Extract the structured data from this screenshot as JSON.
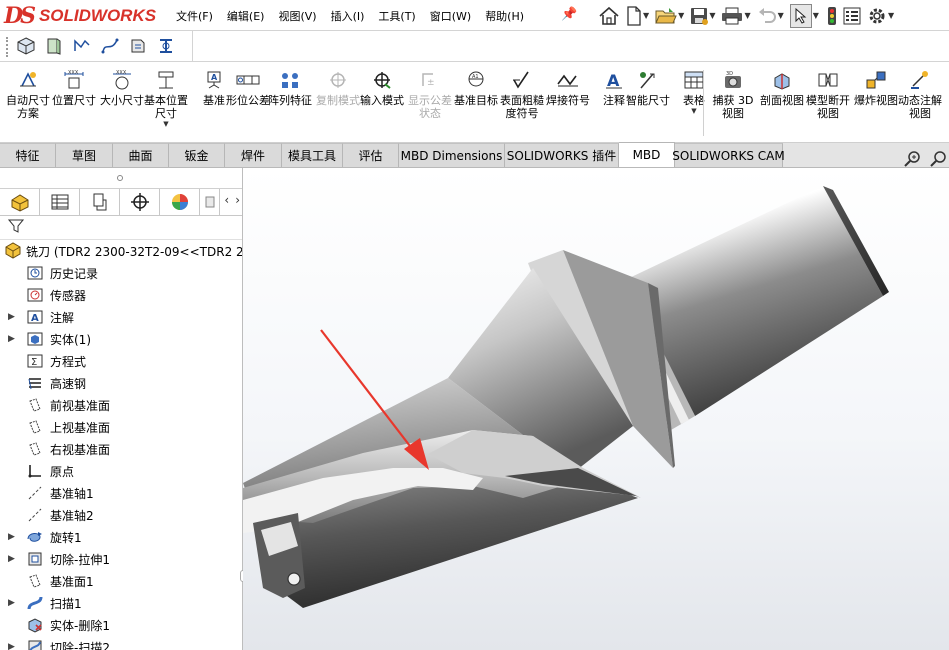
{
  "app": {
    "logo_ds": "DS",
    "logo_text": "SOLIDWORKS"
  },
  "menu": [
    "文件(F)",
    "编辑(E)",
    "视图(V)",
    "插入(I)",
    "工具(T)",
    "窗口(W)",
    "帮助(H)"
  ],
  "quick_access": {
    "icons": [
      "home-icon",
      "new-document-icon",
      "open-folder-icon",
      "save-icon",
      "print-icon",
      "undo-icon",
      "select-arrow-icon",
      "rebuild-traffic-light-icon",
      "file-properties-icon",
      "options-gear-icon"
    ]
  },
  "ribbon": {
    "buttons": [
      {
        "label": "自动尺寸方案",
        "icon": "auto-dimension-icon",
        "enabled": true
      },
      {
        "label": "位置尺寸",
        "icon": "location-dimension-icon",
        "enabled": true
      },
      {
        "label": "大小尺寸",
        "icon": "size-dimension-icon",
        "enabled": true
      },
      {
        "label": "基本位置尺寸",
        "icon": "basic-location-dimension-icon",
        "enabled": true,
        "has_dropdown": true
      },
      {
        "label": "基准",
        "icon": "datum-icon",
        "enabled": true
      },
      {
        "label": "形位公差",
        "icon": "geometric-tolerance-icon",
        "enabled": true
      },
      {
        "label": "阵列特征",
        "icon": "pattern-feature-icon",
        "enabled": true
      },
      {
        "label": "复制模式",
        "icon": "copy-scheme-icon",
        "enabled": false
      },
      {
        "label": "输入模式",
        "icon": "import-scheme-icon",
        "enabled": true
      },
      {
        "label": "显示公差状态",
        "icon": "show-tolerance-status-icon",
        "enabled": false
      },
      {
        "label": "基准目标",
        "icon": "datum-target-icon",
        "enabled": true
      },
      {
        "label": "表面粗糙度符号",
        "icon": "surface-finish-icon",
        "enabled": true
      },
      {
        "label": "焊接符号",
        "icon": "weld-symbol-icon",
        "enabled": true
      },
      {
        "label": "注释",
        "icon": "note-icon",
        "enabled": true
      },
      {
        "label": "智能尺寸",
        "icon": "smart-dimension-icon",
        "enabled": true
      },
      {
        "label": "表格",
        "icon": "table-icon",
        "enabled": true,
        "has_dropdown": true
      },
      {
        "label": "捕获 3D 视图",
        "icon": "capture-3d-view-icon",
        "enabled": true
      },
      {
        "label": "剖面视图",
        "icon": "section-view-icon",
        "enabled": true
      },
      {
        "label": "模型断开视图",
        "icon": "model-break-view-icon",
        "enabled": true
      },
      {
        "label": "爆炸视图",
        "icon": "exploded-view-icon",
        "enabled": true
      },
      {
        "label": "动态注解视图",
        "icon": "dynamic-annotation-view-icon",
        "enabled": true
      }
    ]
  },
  "tabs": [
    {
      "label": "特征",
      "active": false
    },
    {
      "label": "草图",
      "active": false
    },
    {
      "label": "曲面",
      "active": false
    },
    {
      "label": "钣金",
      "active": false
    },
    {
      "label": "焊件",
      "active": false
    },
    {
      "label": "模具工具",
      "active": false
    },
    {
      "label": "评估",
      "active": false
    },
    {
      "label": "MBD Dimensions",
      "active": false
    },
    {
      "label": "SOLIDWORKS 插件",
      "active": false
    },
    {
      "label": "MBD",
      "active": true
    },
    {
      "label": "SOLIDWORKS CAM",
      "active": false
    }
  ],
  "feature_tree": {
    "root": "铣刀  (TDR2 2300-32T2-09<<TDR2 2",
    "items": [
      {
        "label": "历史记录",
        "icon": "history-icon",
        "expandable": false
      },
      {
        "label": "传感器",
        "icon": "sensor-icon",
        "expandable": false
      },
      {
        "label": "注解",
        "icon": "annotation-icon",
        "expandable": true
      },
      {
        "label": "实体(1)",
        "icon": "solid-bodies-icon",
        "expandable": true
      },
      {
        "label": "方程式",
        "icon": "equation-icon",
        "expandable": false
      },
      {
        "label": "高速钢",
        "icon": "material-icon",
        "expandable": false
      },
      {
        "label": "前视基准面",
        "icon": "plane-icon",
        "expandable": false
      },
      {
        "label": "上视基准面",
        "icon": "plane-icon",
        "expandable": false
      },
      {
        "label": "右视基准面",
        "icon": "plane-icon",
        "expandable": false
      },
      {
        "label": "原点",
        "icon": "origin-icon",
        "expandable": false
      },
      {
        "label": "基准轴1",
        "icon": "axis-icon",
        "expandable": false
      },
      {
        "label": "基准轴2",
        "icon": "axis-icon",
        "expandable": false
      },
      {
        "label": "旋转1",
        "icon": "revolve-icon",
        "expandable": true
      },
      {
        "label": "切除-拉伸1",
        "icon": "extrude-cut-icon",
        "expandable": true
      },
      {
        "label": "基准面1",
        "icon": "plane-icon",
        "expandable": false
      },
      {
        "label": "扫描1",
        "icon": "sweep-icon",
        "expandable": true
      },
      {
        "label": "实体-删除1",
        "icon": "delete-body-icon",
        "expandable": false
      },
      {
        "label": "切除-扫描2",
        "icon": "sweep-cut-icon",
        "expandable": true
      }
    ]
  },
  "colors": {
    "brand": "#d8322a",
    "annotation_arrow": "#e8372c"
  }
}
